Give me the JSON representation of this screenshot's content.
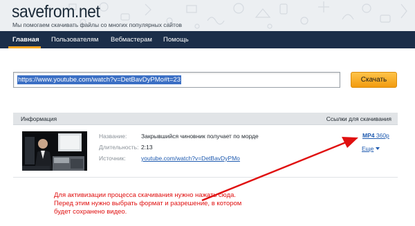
{
  "header": {
    "logo": "savefrom.net",
    "tagline": "Мы помогаем скачивать файлы со многих популярных сайтов"
  },
  "nav": {
    "items": [
      "Главная",
      "Пользователям",
      "Вебмастерам",
      "Помощь"
    ],
    "active": "Главная"
  },
  "search": {
    "url_value": "https://www.youtube.com/watch?v=DetBavDyPMo#t=23",
    "button_label": "Скачать"
  },
  "results": {
    "info_header": "Информация",
    "links_header": "Ссылки для скачивания",
    "fields": [
      {
        "label": "Название:",
        "value": "Закрывшийся чиновник получает по морде"
      },
      {
        "label": "Длительность:",
        "value": "2:13"
      },
      {
        "label": "Источник:",
        "value": "youtube.com/watch?v=DetBavDyPMo"
      }
    ],
    "download_format": "MP4",
    "download_quality": "360p",
    "more_label": "Еще"
  },
  "annotation": {
    "text": "Для активизации процесса скачивания нужно нажать сюда. Перед этим нужно выбрать формат и разрешение, в котором будет сохранено видео."
  },
  "colors": {
    "nav_bg": "#1b2e49",
    "accent": "#f6a623",
    "link": "#1f5bb0",
    "annotation": "#e01010"
  }
}
